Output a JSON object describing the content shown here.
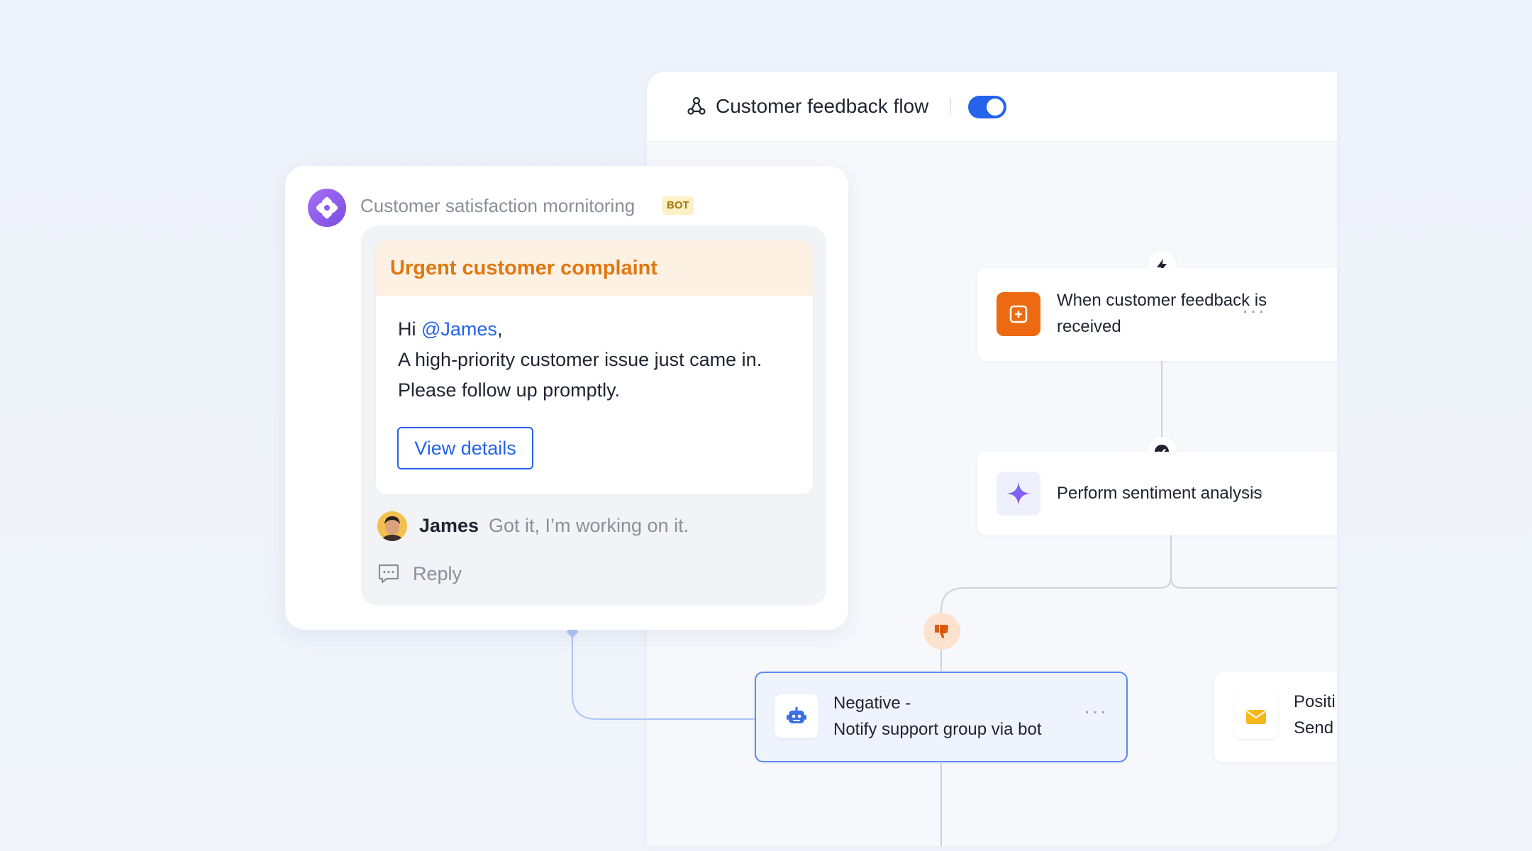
{
  "flow": {
    "title": "Customer feedback flow",
    "toggle_on": true,
    "nodes": {
      "trigger": {
        "line1": "When customer feedback is",
        "line2": "received",
        "more": "···"
      },
      "analysis": {
        "label": "Perform sentiment analysis",
        "more": "···"
      },
      "negative": {
        "line1": "Negative -",
        "line2": "Notify support group via bot",
        "more": "···"
      },
      "positive": {
        "line1": "Positi",
        "line2": "Send"
      }
    }
  },
  "chat": {
    "bot_name": "Customer satisfaction mornitoring",
    "bot_badge": "BOT",
    "message": {
      "title": "Urgent customer complaint",
      "greeting": "Hi ",
      "mention": "@James",
      "greeting_suffix": ",",
      "line2": "A high-priority customer issue just came in.",
      "line3": "Please follow up promptly.",
      "button_label": "View details"
    },
    "reply": {
      "author": "James",
      "text": "Got it, I’m working on it.",
      "action_label": "Reply"
    }
  },
  "colors": {
    "accent": "#2563eb",
    "urgent": "#e07812",
    "trigger_icon": "#ee6a12",
    "bot_avatar": "#8b5cf6",
    "negative_badge": "#fde3cf"
  }
}
